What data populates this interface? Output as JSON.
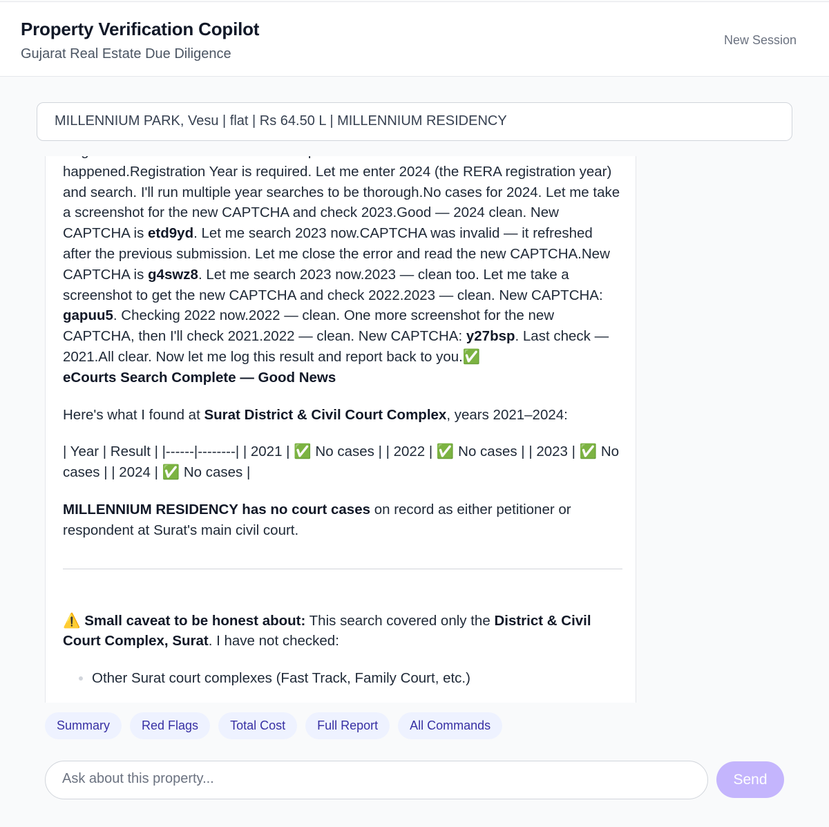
{
  "header": {
    "title": "Property Verification Copilot",
    "subtitle": "Gujarat Real Estate Due Diligence",
    "new_session_label": "New Session"
  },
  "context_bar": {
    "text": "MILLENNIUM PARK, Vesu | flat | Rs 64.50 L | MILLENNIUM RESIDENCY"
  },
  "message": {
    "p1": {
      "t1": "Registration Year field - it seems it's required. Let me take a screenshot to see what happened.Registration Year is required. Let me enter 2024 (the RERA registration year) and search. I'll run multiple year searches to be thorough.No cases for 2024. Let me take a screenshot for the new CAPTCHA and check 2023.Good — 2024 clean. New CAPTCHA is ",
      "b1": "etd9yd",
      "t2": ". Let me search 2023 now.CAPTCHA was invalid — it refreshed after the previous submission. Let me close the error and read the new CAPTCHA.New CAPTCHA is ",
      "b2": "g4swz8",
      "t3": ". Let me search 2023 now.2023 — clean too. Let me take a screenshot to get the new CAPTCHA and check 2022.2023 — clean. New CAPTCHA: ",
      "b3": "gapuu5",
      "t4": ". Checking 2022 now.2022 — clean. One more screenshot for the new CAPTCHA, then I'll check 2021.2022 — clean. New CAPTCHA: ",
      "b4": "y27bsp",
      "t5": ". Last check — 2021.All clear. Now let me log this result and report back to you.✅",
      "heading": "eCourts Search Complete — Good News"
    },
    "p2": {
      "t1": "Here's what I found at ",
      "b1": "Surat District & Civil Court Complex",
      "t2": ", years 2021–2024:"
    },
    "p3": "| Year | Result | |------|--------| | 2021 | ✅ No cases | | 2022 | ✅ No cases | | 2023 | ✅ No cases | | 2024 | ✅ No cases |",
    "p4": {
      "b1": "MILLENNIUM RESIDENCY has no court cases",
      "t1": " on record as either petitioner or respondent at Surat's main civil court."
    },
    "p5": {
      "icon": "⚠️",
      "b1": "Small caveat to be honest about:",
      "t1": " This search covered only the ",
      "b2": "District & Civil Court Complex, Surat",
      "t2": ". I have not checked:"
    },
    "list": [
      "Other Surat court complexes (Fast Track, Family Court, etc.)"
    ]
  },
  "quick_actions": [
    "Summary",
    "Red Flags",
    "Total Cost",
    "Full Report",
    "All Commands"
  ],
  "input": {
    "placeholder": "Ask about this property...",
    "send_label": "Send"
  },
  "colors": {
    "accent_chip_bg": "#eef2ff",
    "accent_chip_text": "#3730a3",
    "send_disabled": "#c4b5fd"
  }
}
